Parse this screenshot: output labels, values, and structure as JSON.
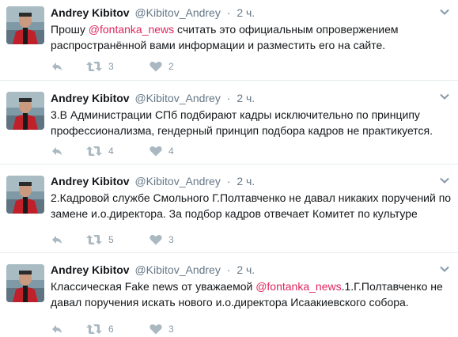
{
  "colors": {
    "mention": "#e0245e",
    "meta": "#657786",
    "action": "#8899a6",
    "divider": "#e6ecf0"
  },
  "icons": {
    "reply": "reply-icon",
    "retweet": "retweet-icon",
    "like": "heart-icon",
    "more": "chevron-down-icon"
  },
  "tweets": [
    {
      "name": "Andrey Kibitov",
      "handle": "@Kibitov_Andrey",
      "dot": "·",
      "time": "2 ч.",
      "text_before": "Прошу ",
      "mention": "@fontanka_news",
      "text_after": " считать это официальным опровержением распространённой вами информации и разместить его на сайте.",
      "retweets": "3",
      "likes": "2"
    },
    {
      "name": "Andrey Kibitov",
      "handle": "@Kibitov_Andrey",
      "dot": "·",
      "time": "2 ч.",
      "text_before": "3.В Администрации СПб подбирают кадры исключительно по принципу профессионализма, гендерный принцип подбора кадров не практикуется.",
      "mention": "",
      "text_after": "",
      "retweets": "4",
      "likes": "4"
    },
    {
      "name": "Andrey Kibitov",
      "handle": "@Kibitov_Andrey",
      "dot": "·",
      "time": "2 ч.",
      "text_before": "2.Кадровой службе Смольного Г.Полтавченко не давал никаких поручений по замене и.о.директора. За подбор кадров отвечает Комитет по культуре",
      "mention": "",
      "text_after": "",
      "retweets": "5",
      "likes": "3"
    },
    {
      "name": "Andrey Kibitov",
      "handle": "@Kibitov_Andrey",
      "dot": "·",
      "time": "2 ч.",
      "text_before": "Классическая Fake news от уважаемой ",
      "mention": "@fontanka_news",
      "text_after": ".1.Г.Полтавченко не давал поручения искать нового и.о.директора Исаакиевского собора.",
      "retweets": "6",
      "likes": "3"
    }
  ]
}
